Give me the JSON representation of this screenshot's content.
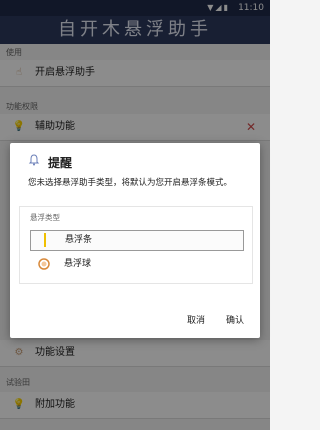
{
  "statusbar": {
    "time": "11:10",
    "icons_text": "▼◢▮"
  },
  "header": {
    "title": "自开木悬浮助手"
  },
  "sections": {
    "use": "使用",
    "permissions": "功能权限",
    "trial": "试验田"
  },
  "items": {
    "open_float": "开启悬浮助手",
    "accessibility": "辅助功能",
    "settings": "功能设置",
    "extra": "附加功能"
  },
  "dialog": {
    "title": "提醒",
    "message": "您未选择悬浮助手类型，将默认为您开启悬浮条模式。",
    "group_label": "悬浮类型",
    "options": [
      {
        "label": "悬浮条",
        "icon": "bar-icon",
        "selected": true
      },
      {
        "label": "悬浮球",
        "icon": "ball-icon",
        "selected": false
      }
    ],
    "cancel": "取消",
    "confirm": "确认"
  },
  "colors": {
    "header_bg": "#2c3a5e",
    "accent": "#d24c4c",
    "bar_icon": "#f0c000",
    "ball_icon": "#d88a3c"
  }
}
